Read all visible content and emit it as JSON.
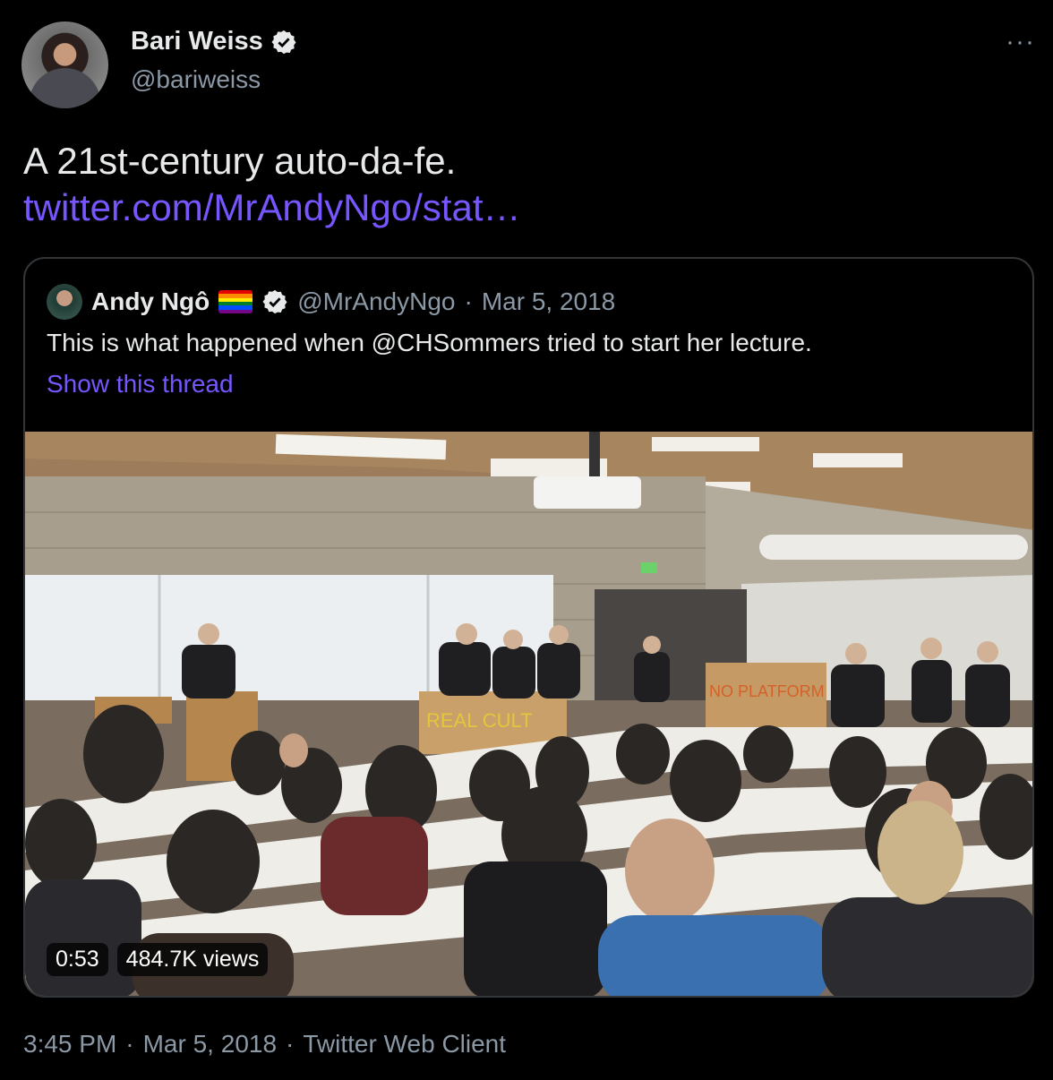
{
  "author": {
    "name": "Bari Weiss",
    "handle": "@bariweiss"
  },
  "more_label": "···",
  "tweet": {
    "text": "A 21st-century auto-da-fe.",
    "link_text": "twitter.com/MrAndyNgo/stat…"
  },
  "quoted": {
    "name": "Andy Ngô",
    "handle": "@MrAndyNgo",
    "separator": "·",
    "date": "Mar 5, 2018",
    "text": "This is what happened when @CHSommers tried to start her lecture.",
    "show_thread": "Show this thread",
    "video": {
      "duration": "0:53",
      "views": "484.7K views",
      "banner_left": "REAL CULT",
      "banner_right": "NO PLATFORM"
    }
  },
  "meta": {
    "time": "3:45 PM",
    "separator": "·",
    "date": "Mar 5, 2018",
    "client": "Twitter Web Client"
  },
  "colors": {
    "link": "#7856ff",
    "secondary_text": "#8b98a5",
    "verified": "#e7e9ea"
  }
}
